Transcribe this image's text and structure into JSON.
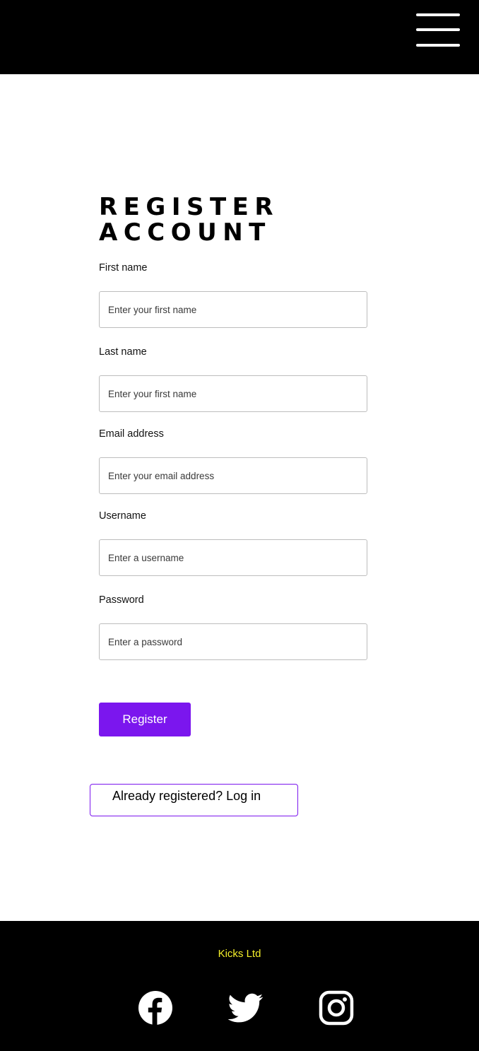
{
  "header": {
    "menu_icon": "hamburger-menu-icon"
  },
  "form": {
    "title_line1": "REGISTER",
    "title_line2": "ACCOUNT",
    "fields": [
      {
        "label": "First name",
        "placeholder": "Enter your first name",
        "value": ""
      },
      {
        "label": "Last name",
        "placeholder": "Enter your first name",
        "value": ""
      },
      {
        "label": "Email address",
        "placeholder": "Enter your email address",
        "value": ""
      },
      {
        "label": "Username",
        "placeholder": "Enter a username",
        "value": ""
      },
      {
        "label": "Password",
        "placeholder": "Enter a password",
        "value": ""
      }
    ],
    "register_label": "Register",
    "login_link_label": "Already registered? Log in"
  },
  "footer": {
    "brand": "Kicks Ltd",
    "social_icons": [
      "facebook-icon",
      "twitter-icon",
      "instagram-icon"
    ]
  },
  "colors": {
    "accent": "#7b16ee",
    "brand_text": "#f4ef2a",
    "header_bg": "#000000",
    "footer_bg": "#000000"
  }
}
